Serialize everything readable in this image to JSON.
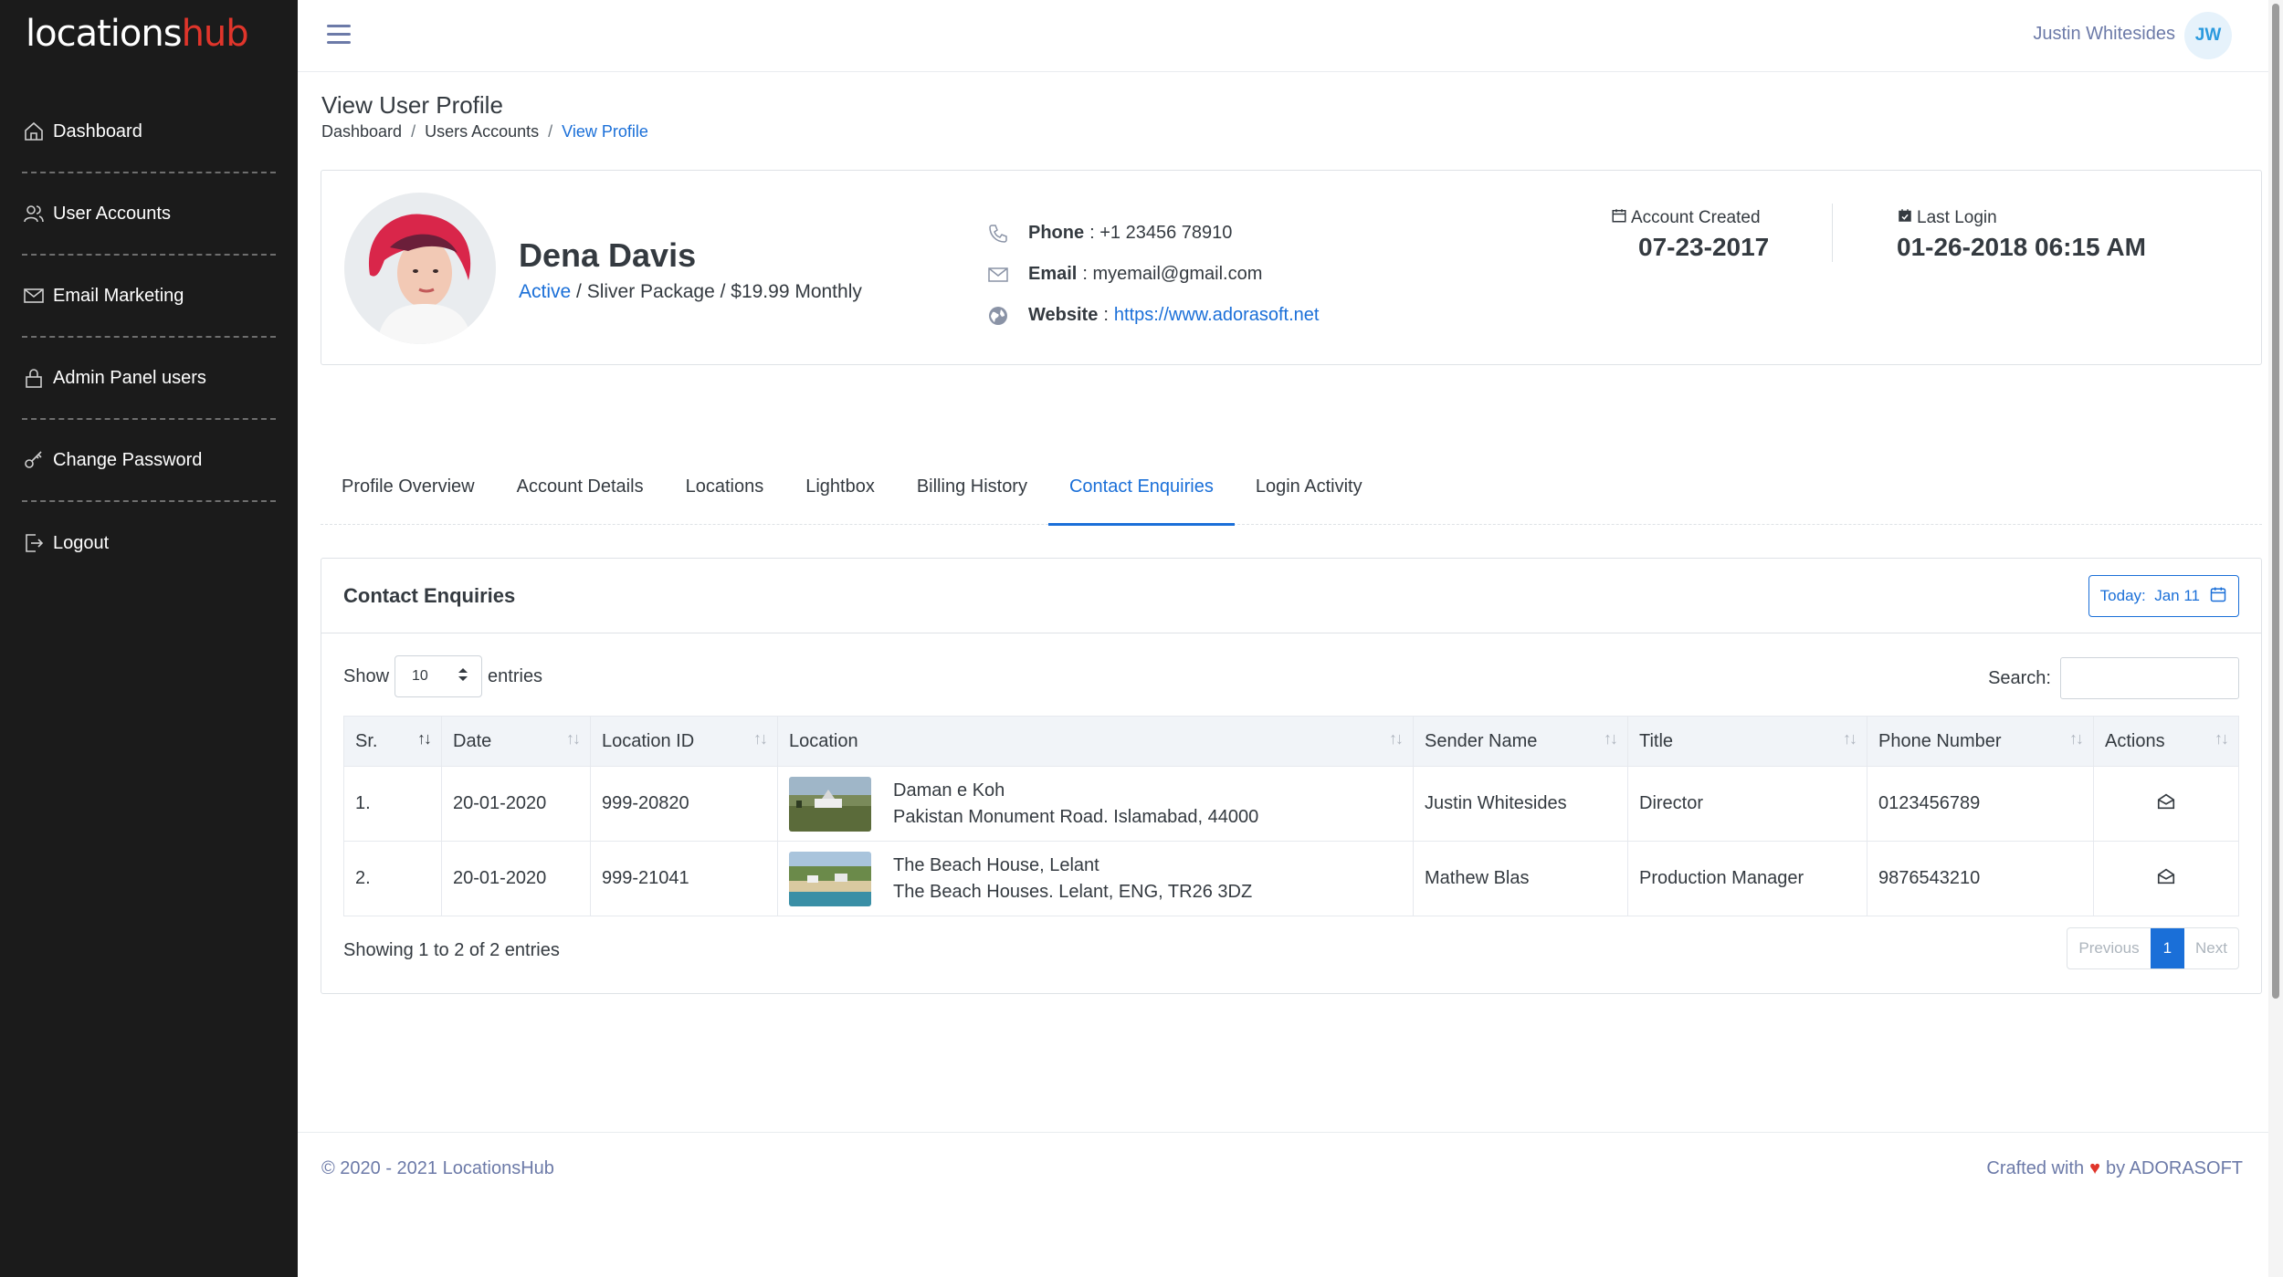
{
  "brand": {
    "part1": "locations",
    "part2": "hub"
  },
  "sidebar": {
    "items": [
      {
        "label": "Dashboard",
        "icon": "home-icon"
      },
      {
        "label": "User Accounts",
        "icon": "users-icon"
      },
      {
        "label": "Email Marketing",
        "icon": "mail-icon"
      },
      {
        "label": "Admin Panel users",
        "icon": "lock-icon"
      },
      {
        "label": "Change Password",
        "icon": "key-icon"
      },
      {
        "label": "Logout",
        "icon": "logout-icon"
      }
    ]
  },
  "header": {
    "user_name": "Justin Whitesides",
    "user_initials": "JW"
  },
  "page": {
    "title": "View User Profile",
    "breadcrumb": [
      "Dashboard",
      "Users Accounts",
      "View Profile"
    ],
    "breadcrumb_sep": "/"
  },
  "profile": {
    "name": "Dena Davis",
    "status": "Active",
    "package": " / Sliver Package / $19.99 Monthly",
    "phone_label": "Phone",
    "phone": ": +1 23456 78910",
    "email_label": "Email",
    "email": ": myemail@gmail.com",
    "website_label": "Website",
    "website_sep": ":",
    "website": "https://www.adorasoft.net",
    "created_label": "Account Created",
    "created": "07-23-2017",
    "last_login_label": "Last Login",
    "last_login": "01-26-2018 06:15 AM"
  },
  "tabs": [
    "Profile Overview",
    "Account Details",
    "Locations",
    "Lightbox",
    "Billing History",
    "Contact Enquiries",
    "Login Activity"
  ],
  "active_tab": "Contact Enquiries",
  "enquiries": {
    "title": "Contact Enquiries",
    "date_button": "Today:  Jan 11",
    "show_label": "Show",
    "entries_value": "10",
    "entries_label": "entries",
    "search_label": "Search:",
    "columns": [
      "Sr.",
      "Date",
      "Location ID",
      "Location",
      "Sender Name",
      "Title",
      "Phone Number",
      "Actions"
    ],
    "rows": [
      {
        "sr": "1.",
        "date": "20-01-2020",
        "location_id": "999-20820",
        "loc_name": "Daman e Koh",
        "loc_address": "Pakistan Monument Road. Islamabad, 44000",
        "sender": "Justin Whitesides",
        "title": "Director",
        "phone": "0123456789"
      },
      {
        "sr": "2.",
        "date": "20-01-2020",
        "location_id": "999-21041",
        "loc_name": "The Beach House, Lelant",
        "loc_address": "The Beach Houses. Lelant, ENG, TR26 3DZ",
        "sender": "Mathew Blas",
        "title": "Production Manager",
        "phone": "9876543210"
      }
    ],
    "showing": "Showing 1 to 2 of 2 entries",
    "pager": {
      "prev": "Previous",
      "current": "1",
      "next": "Next"
    }
  },
  "footer": {
    "left": "© 2020 - 2021 LocationsHub",
    "crafted": "Crafted with",
    "by": "by ADORASOFT"
  },
  "colors": {
    "accent": "#1a6fd8",
    "sidebar": "#1b1b1b",
    "brand_red": "#e0352b"
  }
}
